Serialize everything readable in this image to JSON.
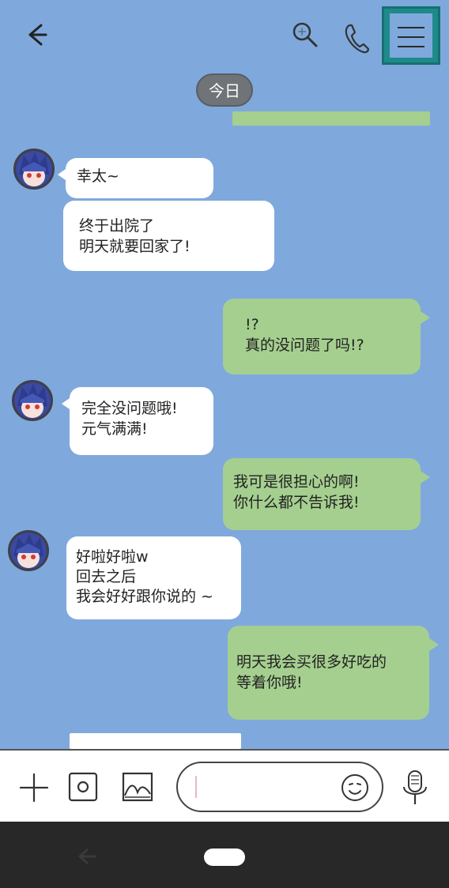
{
  "header": {
    "back_icon": "back-arrow-icon",
    "search_icon": "search-icon",
    "call_icon": "phone-icon",
    "menu_icon": "hamburger-menu-icon"
  },
  "date_label": "今日",
  "messages": [
    {
      "side": "left",
      "text": "幸太~"
    },
    {
      "side": "left",
      "text": "终于出院了\n明天就要回家了!"
    },
    {
      "side": "right",
      "text": "!?\n真的没问题了吗!?"
    },
    {
      "side": "left",
      "text": "完全没问题哦!\n元气满满!"
    },
    {
      "side": "right",
      "text": "我可是很担心的啊!\n你什么都不告诉我!"
    },
    {
      "side": "left",
      "text": "好啦好啦w\n回去之后\n我会好好跟你说的 ~"
    },
    {
      "side": "right",
      "text": "明天我会买很多好吃的\n等着你哦!"
    }
  ],
  "input_bar": {
    "add_icon": "plus-icon",
    "camera_icon": "camera-icon",
    "gallery_icon": "image-icon",
    "input_value": "",
    "emoji_icon": "smiley-icon",
    "mic_icon": "microphone-icon"
  },
  "colors": {
    "background": "#7fa9dc",
    "incoming_bubble": "#ffffff",
    "outgoing_bubble": "#a5cf8f",
    "menu_highlight": "#1f8a8a"
  }
}
